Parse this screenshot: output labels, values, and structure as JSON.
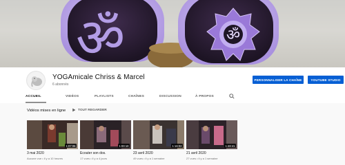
{
  "channel": {
    "name": "YOGAmicale Chriss & Marcel",
    "subscribers": "6 abonnés"
  },
  "buttons": {
    "customize": "PERSONNALISER LA CHAÎNE",
    "studio": "YOUTUBE STUDIO"
  },
  "tabs": [
    {
      "label": "ACCUEIL",
      "active": true
    },
    {
      "label": "VIDÉOS"
    },
    {
      "label": "PLAYLISTS"
    },
    {
      "label": "CHAÎNES"
    },
    {
      "label": "DISCUSSION"
    },
    {
      "label": "À PROPOS"
    }
  ],
  "section": {
    "title": "Vidéos mises en ligne",
    "play_all": "TOUT REGARDER"
  },
  "videos": [
    {
      "title": "3 mai 2020",
      "meta": "Aucune vue • il y a 10 heures",
      "duration": "1:07:06"
    },
    {
      "title": "Ecouter son dos.",
      "meta": "17 vues • il y a 4 jours",
      "duration": "1:00:10"
    },
    {
      "title": "23 avril 2020",
      "meta": "49 vues • il y a 1 semaine",
      "duration": "1:16:02"
    },
    {
      "title": "21 avril 2020",
      "meta": "27 vues • il y a 1 semaine",
      "duration": "1:48:41"
    }
  ],
  "colors": {
    "accent_button": "#065fd4",
    "cushion_purple": "#2f1f3a",
    "lavender": "#b9a6e6"
  }
}
